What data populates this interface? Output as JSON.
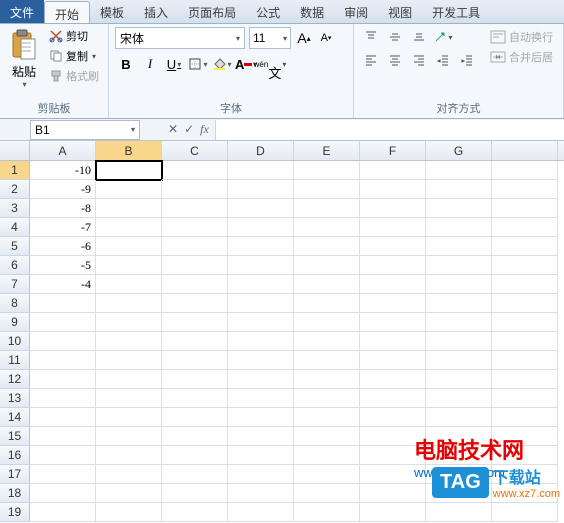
{
  "tabs": {
    "file": "文件",
    "home": "开始",
    "template": "模板",
    "insert": "插入",
    "pagelayout": "页面布局",
    "formula": "公式",
    "data": "数据",
    "review": "审阅",
    "view": "视图",
    "developer": "开发工具"
  },
  "ribbon": {
    "clipboard": {
      "paste": "粘贴",
      "cut": "剪切",
      "copy": "复制",
      "format_painter": "格式刷",
      "label": "剪贴板"
    },
    "font": {
      "name": "宋体",
      "size": "11",
      "bold": "B",
      "italic": "I",
      "underline": "U",
      "label": "字体"
    },
    "align": {
      "wrap": "自动换行",
      "merge": "合并后居",
      "label": "对齐方式"
    }
  },
  "namebox": "B1",
  "columns": [
    "A",
    "B",
    "C",
    "D",
    "E",
    "F",
    "G",
    ""
  ],
  "row_count": 19,
  "cells": {
    "A1": "-10",
    "A2": "-9",
    "A3": "-8",
    "A4": "-7",
    "A5": "-6",
    "A6": "-5",
    "A7": "-4"
  },
  "active_cell": "B1",
  "watermark1": {
    "title": "电脑技术网",
    "url": "www.tagxp.com"
  },
  "watermark2": {
    "badge": "TAG",
    "title": "下载站",
    "url": "www.xz7.com"
  }
}
